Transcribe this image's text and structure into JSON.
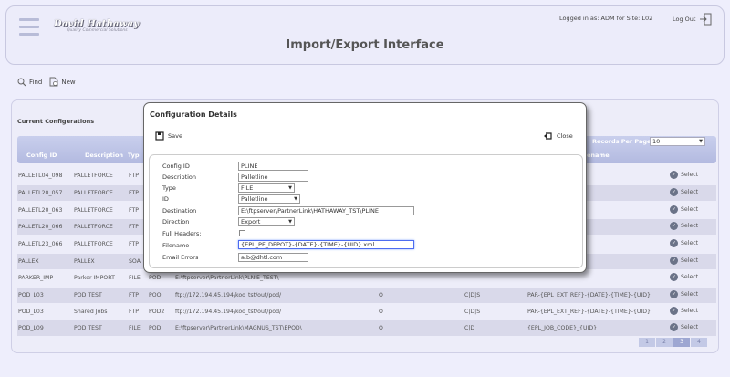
{
  "header": {
    "logo_main": "David Hathaway",
    "logo_sub": "Quality Commercial Solutions",
    "title": "Import/Export Interface",
    "login_info": "Logged in as: ADM for Site: L02",
    "logout_label": "Log Out"
  },
  "toolbar": {
    "find_label": "Find",
    "new_label": "New"
  },
  "config": {
    "section_title": "Current Configurations",
    "records_per_page_label": "Records Per Page:",
    "records_per_page_value": "10",
    "columns": [
      "Config ID",
      "Description",
      "Typ",
      "ename"
    ],
    "rows": [
      {
        "id": "PALLETL04_098",
        "desc": "PALLETFORCE",
        "type": "FTP",
        "select": "Select"
      },
      {
        "id": "PALLETL20_057",
        "desc": "PALLETFORCE",
        "type": "FTP",
        "select": "Select"
      },
      {
        "id": "PALLETL20_063",
        "desc": "PALLETFORCE",
        "type": "FTP",
        "select": "Select"
      },
      {
        "id": "PALLETL20_066",
        "desc": "PALLETFORCE",
        "type": "FTP",
        "select": "Select"
      },
      {
        "id": "PALLETL23_066",
        "desc": "PALLETFORCE",
        "type": "FTP",
        "select": "Select"
      },
      {
        "id": "PALLEX",
        "desc": "PALLEX",
        "type": "SOA",
        "select": "Select"
      },
      {
        "id": "PARKER_IMP",
        "desc": "Parker IMPORT",
        "type": "FILE",
        "iface": "POD",
        "dest": "E:\\ftpserver\\PartnerLink\\PLNIE_TEST\\",
        "select": "Select"
      },
      {
        "id": "POD_L03",
        "desc": "POD TEST",
        "type": "FTP",
        "iface": "POO",
        "dest": "ftp://172.194.45.194/koo_tst/out/pod/",
        "o": "O",
        "flags": "C|D|S",
        "fname": "PAR-{EPL_EXT_REF}-{DATE}-{TIME}-{UID}",
        "select": "Select"
      },
      {
        "id": "POD_L03",
        "desc": "Shared Jobs",
        "type": "FTP",
        "iface": "POD2",
        "dest": "ftp://172.194.45.194/koo_tst/out/pod/",
        "o": "O",
        "flags": "C|D|S",
        "fname": "PAR-{EPL_EXT_REF}-{DATE}-{TIME}-{UID}",
        "select": "Select"
      },
      {
        "id": "POD_L09",
        "desc": "POD TEST",
        "type": "FILE",
        "iface": "POD",
        "dest": "E:\\ftpserver\\PartnerLink\\MAGNUS_TST\\EPOD\\",
        "o": "O",
        "flags": "C|D",
        "fname": "{EPL_JOB_CODE}_{UID}",
        "select": "Select"
      }
    ],
    "pages": [
      "1",
      "2",
      "3",
      "4"
    ]
  },
  "modal": {
    "title": "Configuration Details",
    "save_label": "Save",
    "close_label": "Close",
    "fields": {
      "config_id": {
        "label": "Config ID",
        "value": "PLINE"
      },
      "description": {
        "label": "Description",
        "value": "Palletline"
      },
      "type": {
        "label": "Type",
        "value": "FILE"
      },
      "id": {
        "label": "ID",
        "value": "Palletline"
      },
      "destination": {
        "label": "Destination",
        "value": "E:\\ftpserver\\PartnerLink\\HATHAWAY_TST\\PLINE"
      },
      "direction": {
        "label": "Direction",
        "value": "Export"
      },
      "full_headers": {
        "label": "Full Headers:"
      },
      "filename": {
        "label": "Filename",
        "value": "{EPL_PF_DEPOT}-{DATE}-{TIME}-{UID}.xml"
      },
      "email_errors": {
        "label": "Email Errors",
        "value": "a.b@dhtl.com"
      }
    }
  }
}
